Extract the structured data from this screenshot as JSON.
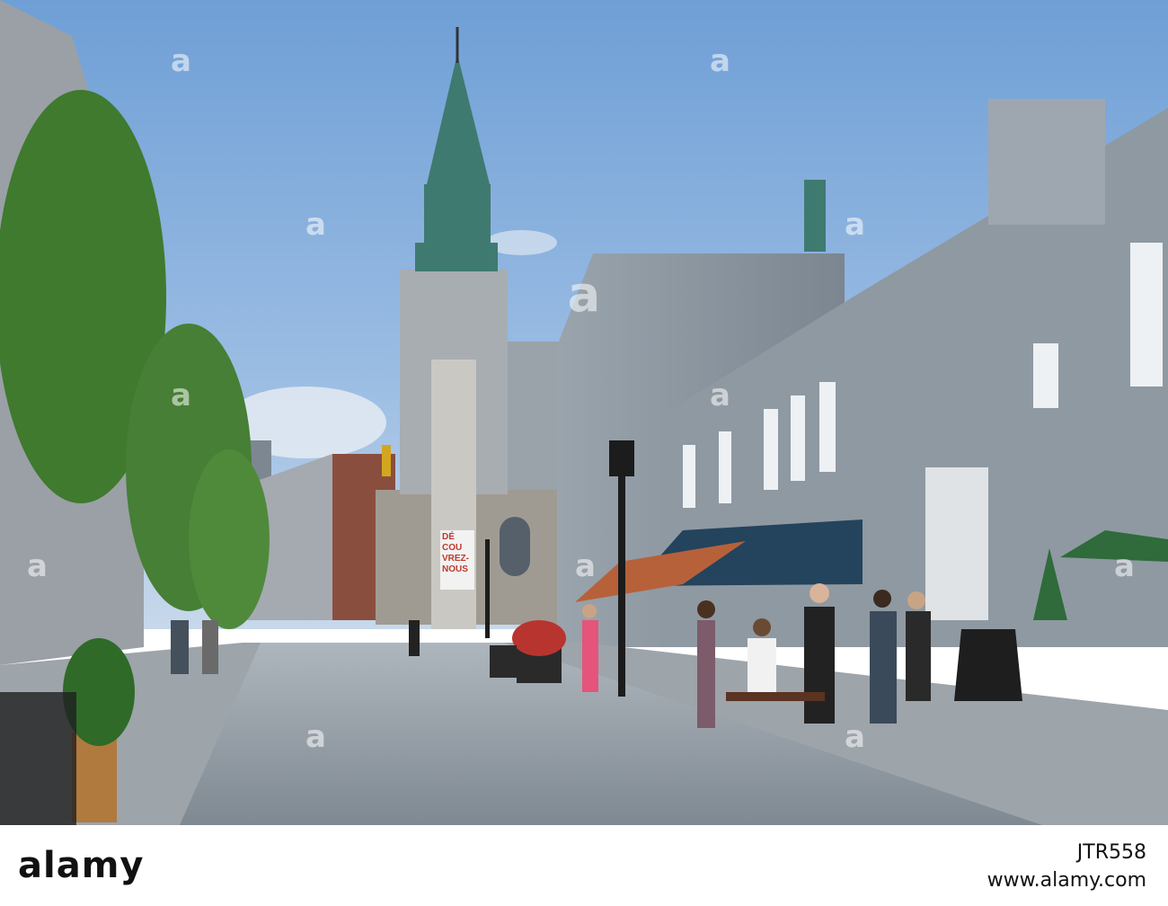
{
  "banner": {
    "line1": "DÉ",
    "line2": "COU",
    "line3": "VREZ-",
    "line4": "NOUS"
  },
  "watermark": {
    "center": "a",
    "letter": "a"
  },
  "footer": {
    "brand": "alamy",
    "image_id": "JTR558",
    "site": "www.alamy.com"
  },
  "colors": {
    "sky": "#7fa8d6",
    "stone": "#8f9aa4",
    "copper": "#3f7a70",
    "awning": "#24435c"
  }
}
